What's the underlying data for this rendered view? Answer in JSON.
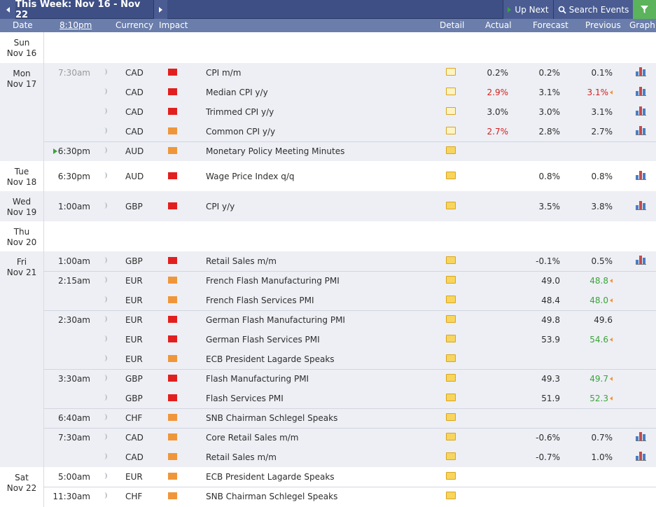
{
  "toolbar": {
    "week_title": "This Week: Nov 16 - Nov 22",
    "up_next_label": "Up Next",
    "search_label": "Search Events"
  },
  "columns": {
    "date": "Date",
    "time": "8:10pm",
    "currency": "Currency",
    "impact": "Impact",
    "detail": "Detail",
    "actual": "Actual",
    "forecast": "Forecast",
    "previous": "Previous",
    "graph": "Graph"
  },
  "colors": {
    "high_impact": "#e21f1f",
    "medium_impact": "#f0963a",
    "better_than_expected": "#3ba33b",
    "worse_than_expected": "#d32020",
    "header_bg": "#3d4f84"
  },
  "days": [
    {
      "day": "Sun",
      "date": "Nov 16"
    },
    {
      "day": "Mon",
      "date": "Nov 17"
    },
    {
      "day": "Tue",
      "date": "Nov 18"
    },
    {
      "day": "Wed",
      "date": "Nov 19"
    },
    {
      "day": "Thu",
      "date": "Nov 20"
    },
    {
      "day": "Fri",
      "date": "Nov 21"
    },
    {
      "day": "Sat",
      "date": "Nov 22"
    }
  ],
  "events": [
    {
      "time": "7:30am",
      "currency": "CAD",
      "impact": "high",
      "event": "CPI m/m",
      "actual": "0.2%",
      "forecast": "0.2%",
      "previous": "0.1%"
    },
    {
      "time": "",
      "currency": "CAD",
      "impact": "high",
      "event": "Median CPI y/y",
      "actual": "2.9%",
      "forecast": "3.1%",
      "previous": "3.1%"
    },
    {
      "time": "",
      "currency": "CAD",
      "impact": "high",
      "event": "Trimmed CPI y/y",
      "actual": "3.0%",
      "forecast": "3.0%",
      "previous": "3.1%"
    },
    {
      "time": "",
      "currency": "CAD",
      "impact": "medium",
      "event": "Common CPI y/y",
      "actual": "2.7%",
      "forecast": "2.8%",
      "previous": "2.7%"
    },
    {
      "time": "6:30pm",
      "currency": "AUD",
      "impact": "medium",
      "event": "Monetary Policy Meeting Minutes",
      "actual": "",
      "forecast": "",
      "previous": ""
    },
    {
      "time": "6:30pm",
      "currency": "AUD",
      "impact": "high",
      "event": "Wage Price Index q/q",
      "actual": "",
      "forecast": "0.8%",
      "previous": "0.8%"
    },
    {
      "time": "1:00am",
      "currency": "GBP",
      "impact": "high",
      "event": "CPI y/y",
      "actual": "",
      "forecast": "3.5%",
      "previous": "3.8%"
    },
    {
      "time": "1:00am",
      "currency": "GBP",
      "impact": "high",
      "event": "Retail Sales m/m",
      "actual": "",
      "forecast": "-0.1%",
      "previous": "0.5%"
    },
    {
      "time": "2:15am",
      "currency": "EUR",
      "impact": "medium",
      "event": "French Flash Manufacturing PMI",
      "actual": "",
      "forecast": "49.0",
      "previous": "48.8"
    },
    {
      "time": "",
      "currency": "EUR",
      "impact": "medium",
      "event": "French Flash Services PMI",
      "actual": "",
      "forecast": "48.4",
      "previous": "48.0"
    },
    {
      "time": "2:30am",
      "currency": "EUR",
      "impact": "high",
      "event": "German Flash Manufacturing PMI",
      "actual": "",
      "forecast": "49.8",
      "previous": "49.6"
    },
    {
      "time": "",
      "currency": "EUR",
      "impact": "high",
      "event": "German Flash Services PMI",
      "actual": "",
      "forecast": "53.9",
      "previous": "54.6"
    },
    {
      "time": "",
      "currency": "EUR",
      "impact": "medium",
      "event": "ECB President Lagarde Speaks",
      "actual": "",
      "forecast": "",
      "previous": ""
    },
    {
      "time": "3:30am",
      "currency": "GBP",
      "impact": "high",
      "event": "Flash Manufacturing PMI",
      "actual": "",
      "forecast": "49.3",
      "previous": "49.7"
    },
    {
      "time": "",
      "currency": "GBP",
      "impact": "high",
      "event": "Flash Services PMI",
      "actual": "",
      "forecast": "51.9",
      "previous": "52.3"
    },
    {
      "time": "6:40am",
      "currency": "CHF",
      "impact": "medium",
      "event": "SNB Chairman Schlegel Speaks",
      "actual": "",
      "forecast": "",
      "previous": ""
    },
    {
      "time": "7:30am",
      "currency": "CAD",
      "impact": "medium",
      "event": "Core Retail Sales m/m",
      "actual": "",
      "forecast": "-0.6%",
      "previous": "0.7%"
    },
    {
      "time": "",
      "currency": "CAD",
      "impact": "medium",
      "event": "Retail Sales m/m",
      "actual": "",
      "forecast": "-0.7%",
      "previous": "1.0%"
    },
    {
      "time": "5:00am",
      "currency": "EUR",
      "impact": "medium",
      "event": "ECB President Lagarde Speaks",
      "actual": "",
      "forecast": "",
      "previous": ""
    },
    {
      "time": "11:30am",
      "currency": "CHF",
      "impact": "medium",
      "event": "SNB Chairman Schlegel Speaks",
      "actual": "",
      "forecast": "",
      "previous": ""
    }
  ]
}
